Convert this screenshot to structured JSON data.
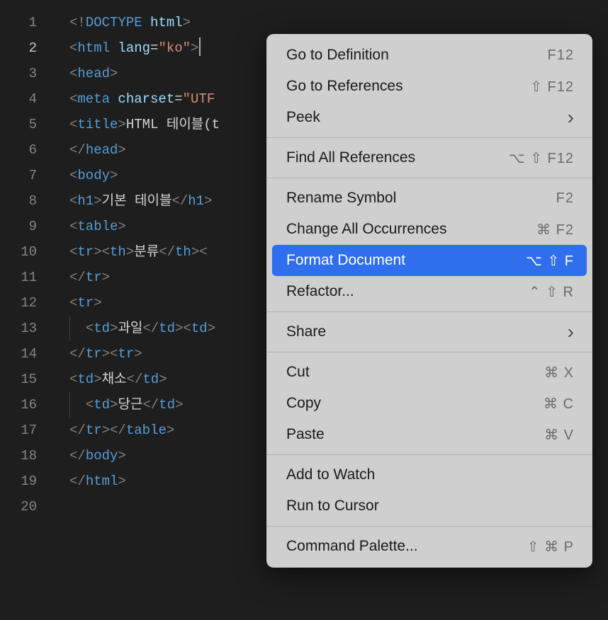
{
  "editor": {
    "activeLine": 2,
    "lines": [
      {
        "n": 1,
        "segments": [
          {
            "t": "p",
            "v": "<!"
          },
          {
            "t": "dt",
            "v": "DOCTYPE"
          },
          {
            "t": "tx",
            "v": " "
          },
          {
            "t": "at",
            "v": "html"
          },
          {
            "t": "p",
            "v": ">"
          }
        ]
      },
      {
        "n": 2,
        "cursor": true,
        "segments": [
          {
            "t": "p",
            "v": "<"
          },
          {
            "t": "tg",
            "v": "html"
          },
          {
            "t": "tx",
            "v": " "
          },
          {
            "t": "at",
            "v": "lang"
          },
          {
            "t": "eq",
            "v": "="
          },
          {
            "t": "st",
            "v": "\"ko\""
          },
          {
            "t": "p",
            "v": ">"
          }
        ]
      },
      {
        "n": 3,
        "segments": [
          {
            "t": "p",
            "v": "<"
          },
          {
            "t": "tg",
            "v": "head"
          },
          {
            "t": "p",
            "v": ">"
          }
        ]
      },
      {
        "n": 4,
        "segments": [
          {
            "t": "p",
            "v": "<"
          },
          {
            "t": "tg",
            "v": "meta"
          },
          {
            "t": "tx",
            "v": " "
          },
          {
            "t": "at",
            "v": "charset"
          },
          {
            "t": "eq",
            "v": "="
          },
          {
            "t": "st",
            "v": "\"UTF"
          }
        ]
      },
      {
        "n": 5,
        "segments": [
          {
            "t": "p",
            "v": "<"
          },
          {
            "t": "tg",
            "v": "title"
          },
          {
            "t": "p",
            "v": ">"
          },
          {
            "t": "tx",
            "v": "HTML 테이블(t"
          }
        ]
      },
      {
        "n": 6,
        "segments": [
          {
            "t": "p",
            "v": "</"
          },
          {
            "t": "tg",
            "v": "head"
          },
          {
            "t": "p",
            "v": ">"
          }
        ]
      },
      {
        "n": 7,
        "segments": [
          {
            "t": "p",
            "v": "<"
          },
          {
            "t": "tg",
            "v": "body"
          },
          {
            "t": "p",
            "v": ">"
          }
        ]
      },
      {
        "n": 8,
        "segments": [
          {
            "t": "p",
            "v": "<"
          },
          {
            "t": "tg",
            "v": "h1"
          },
          {
            "t": "p",
            "v": ">"
          },
          {
            "t": "tx",
            "v": "기본 테이블"
          },
          {
            "t": "p",
            "v": "</"
          },
          {
            "t": "tg",
            "v": "h1"
          },
          {
            "t": "p",
            "v": ">"
          }
        ]
      },
      {
        "n": 9,
        "segments": [
          {
            "t": "p",
            "v": "<"
          },
          {
            "t": "tg",
            "v": "table"
          },
          {
            "t": "p",
            "v": ">"
          }
        ]
      },
      {
        "n": 10,
        "segments": [
          {
            "t": "p",
            "v": "<"
          },
          {
            "t": "tg",
            "v": "tr"
          },
          {
            "t": "p",
            "v": "><"
          },
          {
            "t": "tg",
            "v": "th"
          },
          {
            "t": "p",
            "v": ">"
          },
          {
            "t": "tx",
            "v": "분류"
          },
          {
            "t": "p",
            "v": "</"
          },
          {
            "t": "tg",
            "v": "th"
          },
          {
            "t": "p",
            "v": "><"
          }
        ]
      },
      {
        "n": 11,
        "segments": [
          {
            "t": "p",
            "v": "</"
          },
          {
            "t": "tg",
            "v": "tr"
          },
          {
            "t": "p",
            "v": ">"
          }
        ]
      },
      {
        "n": 12,
        "segments": [
          {
            "t": "p",
            "v": "<"
          },
          {
            "t": "tg",
            "v": "tr"
          },
          {
            "t": "p",
            "v": ">"
          }
        ]
      },
      {
        "n": 13,
        "indent": 1,
        "segments": [
          {
            "t": "p",
            "v": "<"
          },
          {
            "t": "tg",
            "v": "td"
          },
          {
            "t": "p",
            "v": ">"
          },
          {
            "t": "tx",
            "v": "과일"
          },
          {
            "t": "p",
            "v": "</"
          },
          {
            "t": "tg",
            "v": "td"
          },
          {
            "t": "p",
            "v": "><"
          },
          {
            "t": "tg",
            "v": "td"
          },
          {
            "t": "p",
            "v": ">"
          }
        ]
      },
      {
        "n": 14,
        "segments": [
          {
            "t": "p",
            "v": "</"
          },
          {
            "t": "tg",
            "v": "tr"
          },
          {
            "t": "p",
            "v": "><"
          },
          {
            "t": "tg",
            "v": "tr"
          },
          {
            "t": "p",
            "v": ">"
          }
        ]
      },
      {
        "n": 15,
        "segments": [
          {
            "t": "p",
            "v": "<"
          },
          {
            "t": "tg",
            "v": "td"
          },
          {
            "t": "p",
            "v": ">"
          },
          {
            "t": "tx",
            "v": "채소"
          },
          {
            "t": "p",
            "v": "</"
          },
          {
            "t": "tg",
            "v": "td"
          },
          {
            "t": "p",
            "v": ">"
          }
        ]
      },
      {
        "n": 16,
        "indent": 1,
        "segments": [
          {
            "t": "p",
            "v": "<"
          },
          {
            "t": "tg",
            "v": "td"
          },
          {
            "t": "p",
            "v": ">"
          },
          {
            "t": "tx",
            "v": "당근"
          },
          {
            "t": "p",
            "v": "</"
          },
          {
            "t": "tg",
            "v": "td"
          },
          {
            "t": "p",
            "v": ">"
          }
        ]
      },
      {
        "n": 17,
        "segments": [
          {
            "t": "p",
            "v": "</"
          },
          {
            "t": "tg",
            "v": "tr"
          },
          {
            "t": "p",
            "v": "></"
          },
          {
            "t": "tg",
            "v": "table"
          },
          {
            "t": "p",
            "v": ">"
          }
        ]
      },
      {
        "n": 18,
        "segments": [
          {
            "t": "p",
            "v": "</"
          },
          {
            "t": "tg",
            "v": "body"
          },
          {
            "t": "p",
            "v": ">"
          }
        ]
      },
      {
        "n": 19,
        "segments": [
          {
            "t": "p",
            "v": "</"
          },
          {
            "t": "tg",
            "v": "html"
          },
          {
            "t": "p",
            "v": ">"
          }
        ]
      },
      {
        "n": 20,
        "segments": []
      }
    ]
  },
  "contextMenu": {
    "groups": [
      [
        {
          "id": "go-to-definition",
          "label": "Go to Definition",
          "shortcut": "F12"
        },
        {
          "id": "go-to-references",
          "label": "Go to References",
          "shortcut": "⇧ F12"
        },
        {
          "id": "peek",
          "label": "Peek",
          "submenu": true
        }
      ],
      [
        {
          "id": "find-all-references",
          "label": "Find All References",
          "shortcut": "⌥ ⇧ F12"
        }
      ],
      [
        {
          "id": "rename-symbol",
          "label": "Rename Symbol",
          "shortcut": "F2"
        },
        {
          "id": "change-all-occurrences",
          "label": "Change All Occurrences",
          "shortcut": "⌘ F2"
        },
        {
          "id": "format-document",
          "label": "Format Document",
          "shortcut": "⌥ ⇧  F",
          "selected": true
        },
        {
          "id": "refactor",
          "label": "Refactor...",
          "shortcut": "⌃ ⇧  R"
        }
      ],
      [
        {
          "id": "share",
          "label": "Share",
          "submenu": true
        }
      ],
      [
        {
          "id": "cut",
          "label": "Cut",
          "shortcut": "⌘  X"
        },
        {
          "id": "copy",
          "label": "Copy",
          "shortcut": "⌘  C"
        },
        {
          "id": "paste",
          "label": "Paste",
          "shortcut": "⌘  V"
        }
      ],
      [
        {
          "id": "add-to-watch",
          "label": "Add to Watch"
        },
        {
          "id": "run-to-cursor",
          "label": "Run to Cursor"
        }
      ],
      [
        {
          "id": "command-palette",
          "label": "Command Palette...",
          "shortcut": "⇧ ⌘  P"
        }
      ]
    ]
  }
}
